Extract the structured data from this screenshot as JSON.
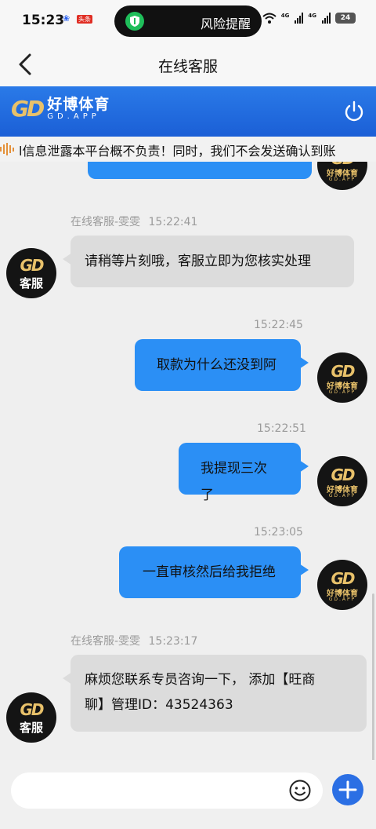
{
  "status_bar": {
    "time": "15:23",
    "toutiao_badge": "头条",
    "pill_label": "风险提醒",
    "net_1": "4G",
    "net_2": "4G",
    "battery": "24"
  },
  "nav": {
    "title": "在线客服"
  },
  "brand": {
    "logo_gd": "GD",
    "name_cn": "好博体育",
    "name_en": "GD.APP"
  },
  "ticker": {
    "text": "l信息泄露本平台概不负责！同时，我们不会发送确认到账"
  },
  "messages": [
    {
      "from": "agent",
      "sender": "在线客服-雯雯",
      "time": "15:22:41",
      "text": "请稍等片刻哦，客服立即为您核实处理"
    },
    {
      "from": "user",
      "time": "15:22:45",
      "text": "取款为什么还没到阿"
    },
    {
      "from": "user",
      "time": "15:22:51",
      "text": "我提现三次了"
    },
    {
      "from": "user",
      "time": "15:23:05",
      "text": "一直审核然后给我拒绝"
    },
    {
      "from": "agent",
      "sender": "在线客服-雯雯",
      "time": "15:23:17",
      "line1": "麻烦您联系专员咨询一下， 添加【旺商",
      "line2": "聊】管理ID：43524363"
    }
  ],
  "avatars": {
    "user_gd": "GD",
    "user_cn": "好博体育",
    "user_en": "GD.APP",
    "agent_gd": "GD",
    "agent_cn": "客服"
  },
  "input": {
    "placeholder": ""
  },
  "colors": {
    "user_bubble": "#2b8ff5",
    "agent_bubble": "#dcdcdc",
    "brand_blue": "#1b5fd6",
    "gold": "#e8c16a"
  },
  "icons": {
    "back": "chevron-left-icon",
    "power": "power-icon",
    "emoji": "smiley-icon",
    "add": "plus-icon",
    "shield": "shield-icon"
  }
}
